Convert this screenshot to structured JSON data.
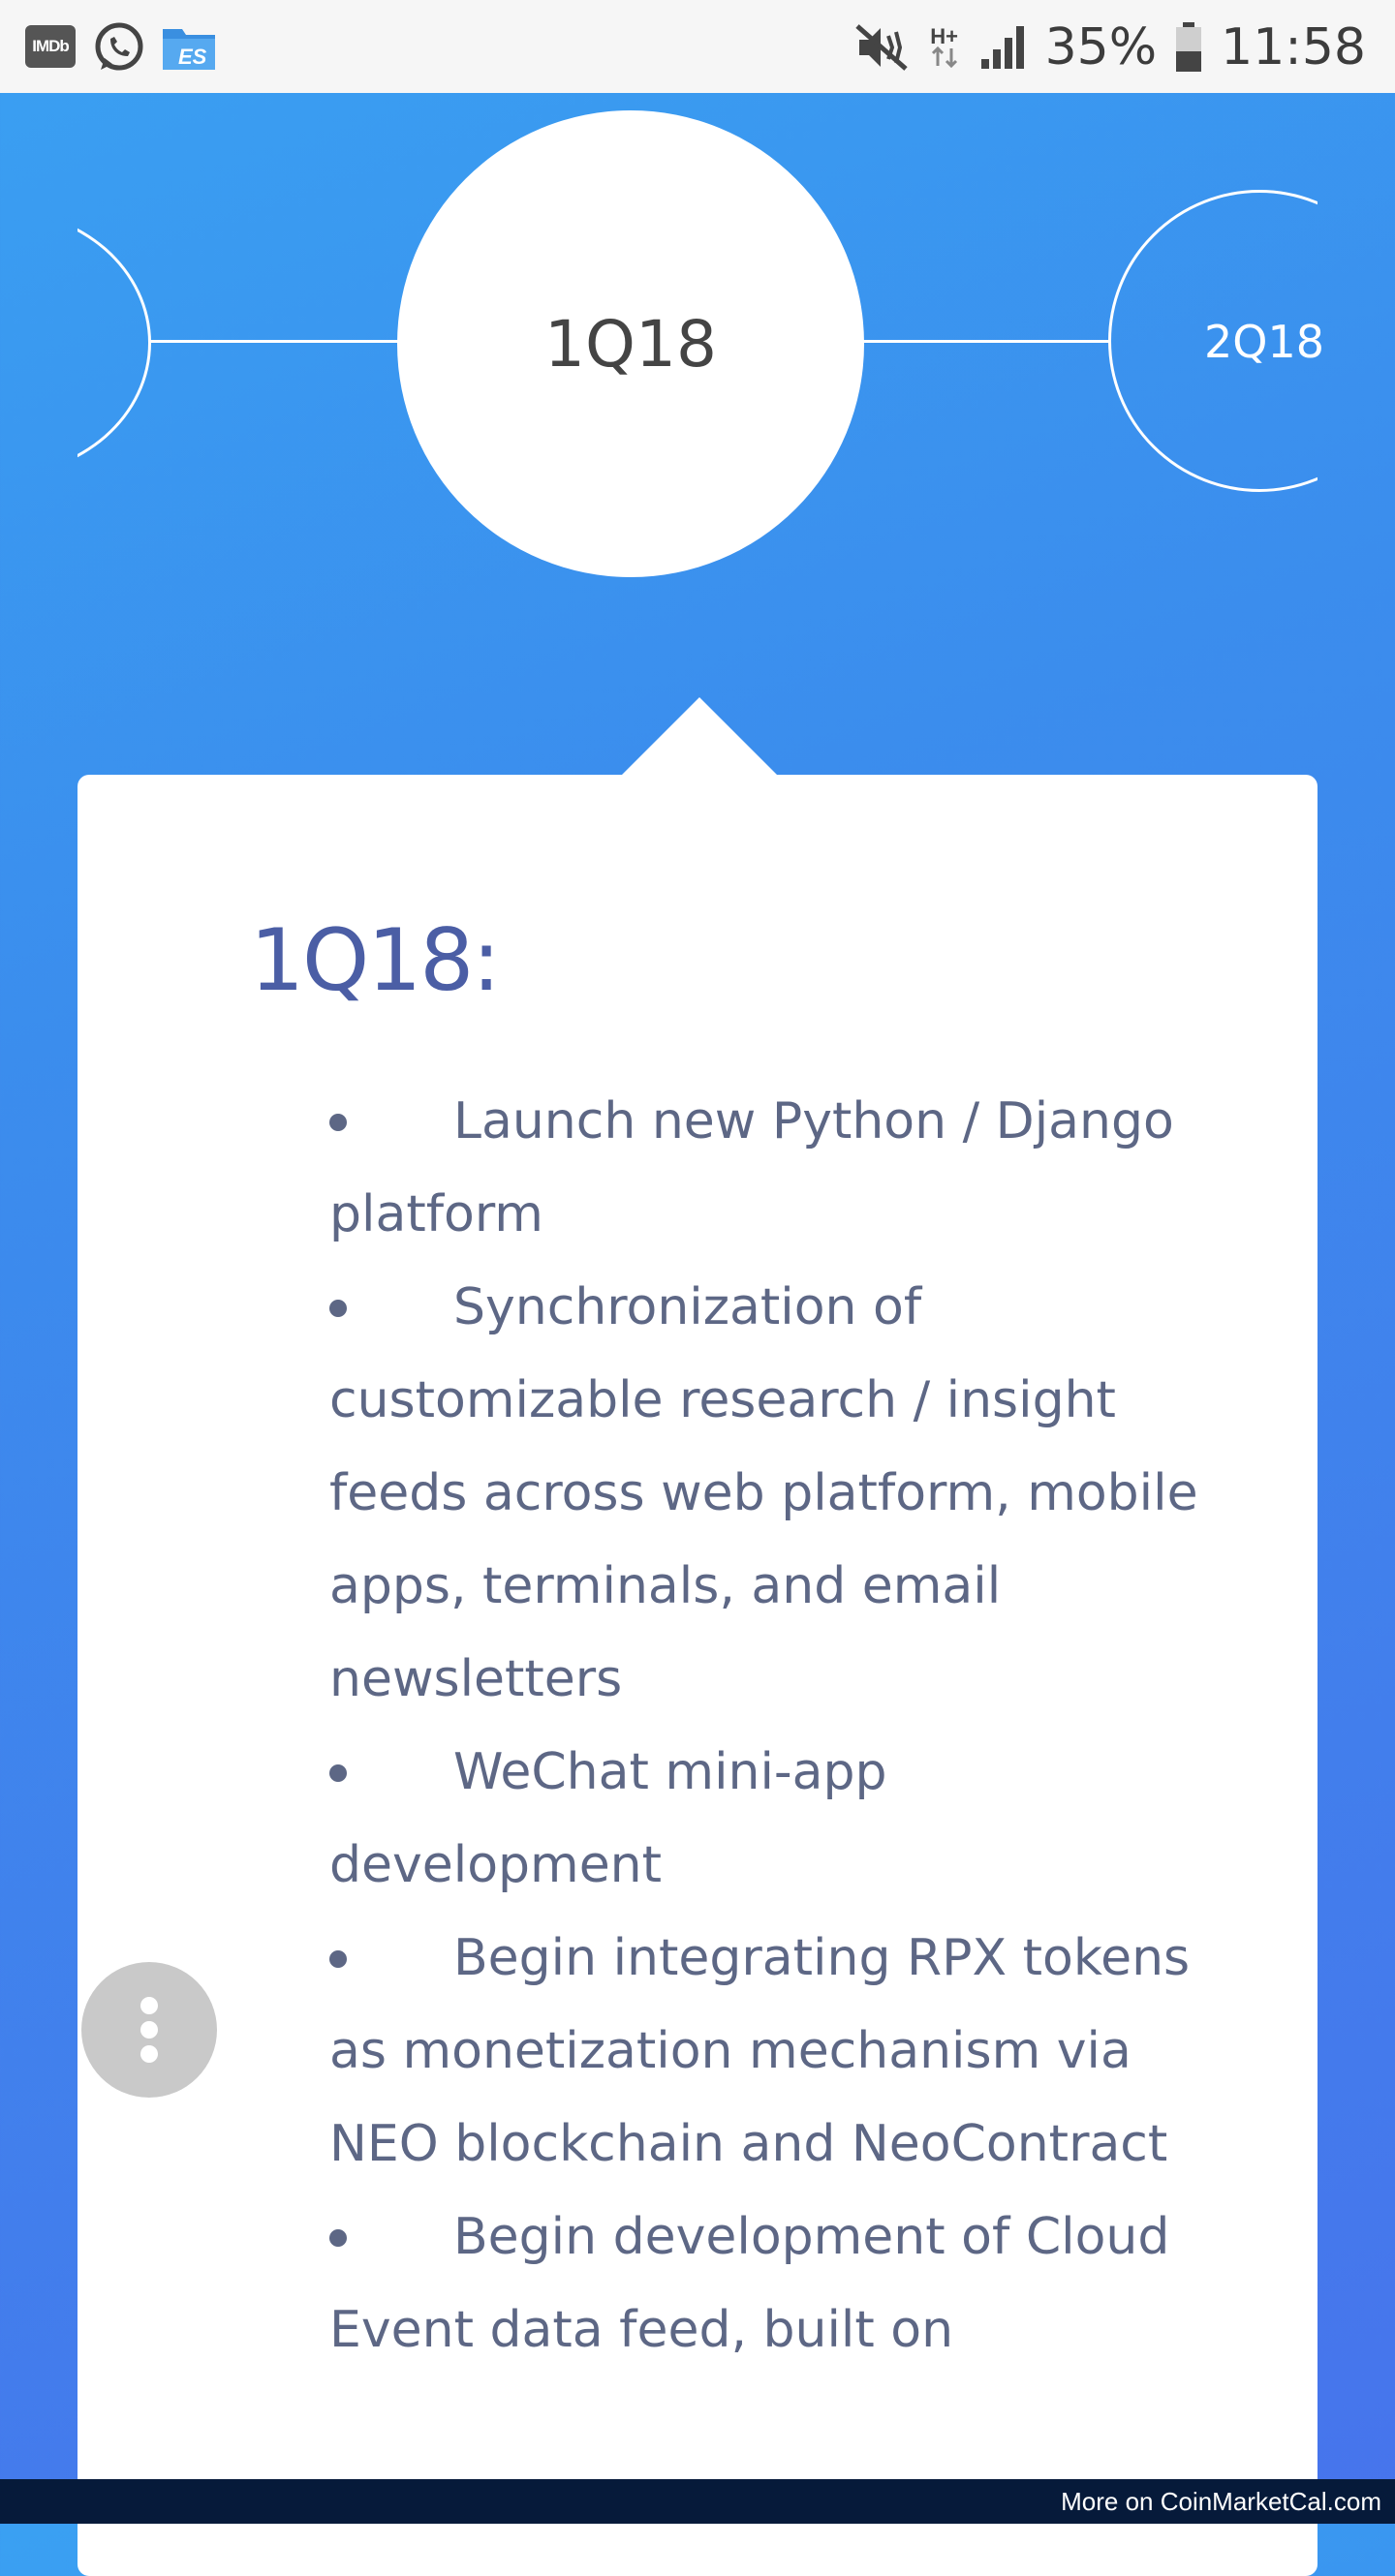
{
  "status_bar": {
    "imdb_label": "IMDb",
    "battery_percent": "35%",
    "network_type": "H+",
    "time": "11:58",
    "icons": [
      "imdb-icon",
      "whatsapp-icon",
      "es-file-explorer-icon",
      "mute-vibrate-icon",
      "network-icon",
      "signal-icon",
      "battery-icon"
    ]
  },
  "timeline": {
    "current": "1Q18",
    "next": "2Q18"
  },
  "card": {
    "title": "1Q18:",
    "items": [
      "Launch new Python / Django platform",
      "Synchronization of customizable research / insight feeds across web platform, mobile apps, terminals, and email newsletters",
      "WeChat mini-app development",
      "Begin integrating RPX tokens as monetization mechanism via NEO blockchain and NeoContract",
      "Begin development of Cloud Event data feed, built on"
    ]
  },
  "footer": {
    "text": "More on CoinMarketCal.com"
  },
  "colors": {
    "background_top": "#3aa0f2",
    "background_bottom": "#4774ec",
    "title": "#4b5ea5",
    "body_text": "#5d6785",
    "footer_bg": "#061a3a"
  }
}
